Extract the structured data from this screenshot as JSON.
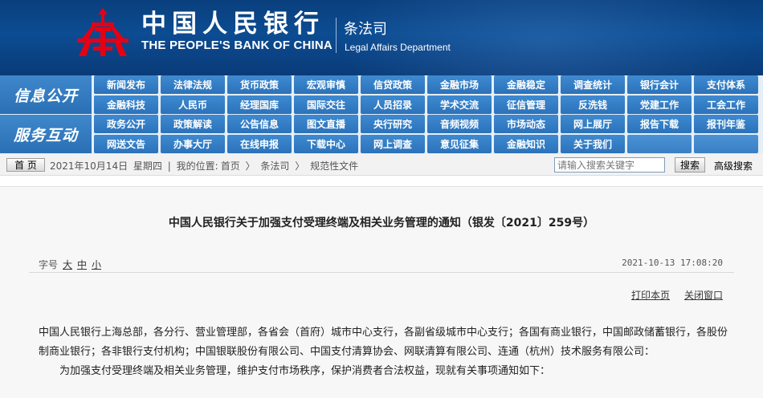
{
  "header": {
    "bank_name_cn": "中国人民银行",
    "bank_name_en": "THE PEOPLE'S BANK OF CHINA",
    "dept_cn": "条法司",
    "dept_en": "Legal Affairs Department",
    "emblem_icon": "pboc-emblem-icon",
    "colors": {
      "banner": "#0c4c92",
      "emblem": "#e60012"
    }
  },
  "nav": {
    "sections": [
      {
        "label": "信息公开",
        "rows": [
          [
            "新闻发布",
            "法律法规",
            "货币政策",
            "宏观审慎",
            "信贷政策",
            "金融市场",
            "金融稳定",
            "调查统计",
            "银行会计",
            "支付体系"
          ],
          [
            "金融科技",
            "人民币",
            "经理国库",
            "国际交往",
            "人员招录",
            "学术交流",
            "征信管理",
            "反洗钱",
            "党建工作",
            "工会工作"
          ]
        ]
      },
      {
        "label": "服务互动",
        "rows": [
          [
            "政务公开",
            "政策解读",
            "公告信息",
            "图文直播",
            "央行研究",
            "音频视频",
            "市场动态",
            "网上展厅",
            "报告下载",
            "报刊年鉴"
          ],
          [
            "网送文告",
            "办事大厅",
            "在线申报",
            "下载中心",
            "网上调查",
            "意见征集",
            "金融知识",
            "关于我们",
            "",
            ""
          ]
        ]
      }
    ],
    "colors": {
      "item": "#2f78be",
      "label": "#2a6fb4",
      "background": "#e6eff8"
    }
  },
  "crumb": {
    "home_label": "首 页",
    "date": "2021年10月14日",
    "weekday": "星期四",
    "location_prefix": "我的位置:",
    "path": [
      "首页",
      "条法司",
      "规范性文件"
    ],
    "separator": "〉",
    "search_placeholder": "请输入搜索关键字",
    "search_button": "搜索",
    "advanced_search": "高级搜索"
  },
  "article": {
    "title": "中国人民银行关于加强支付受理终端及相关业务管理的通知（银发〔2021〕259号）",
    "font_size_label": "字号",
    "font_sizes": [
      "大",
      "中",
      "小"
    ],
    "publish_time": "2021-10-13  17:08:20",
    "print_label": "打印本页",
    "close_label": "关闭窗口",
    "recipients": "中国人民银行上海总部，各分行、营业管理部，各省会（首府）城市中心支行，各副省级城市中心支行；各国有商业银行，中国邮政储蓄银行，各股份制商业银行；各非银行支付机构；中国银联股份有限公司、中国支付清算协会、网联清算有限公司、连通（杭州）技术服务有限公司：",
    "para1": "为加强支付受理终端及相关业务管理，维护支付市场秩序，保护消费者合法权益，现就有关事项通知如下："
  }
}
